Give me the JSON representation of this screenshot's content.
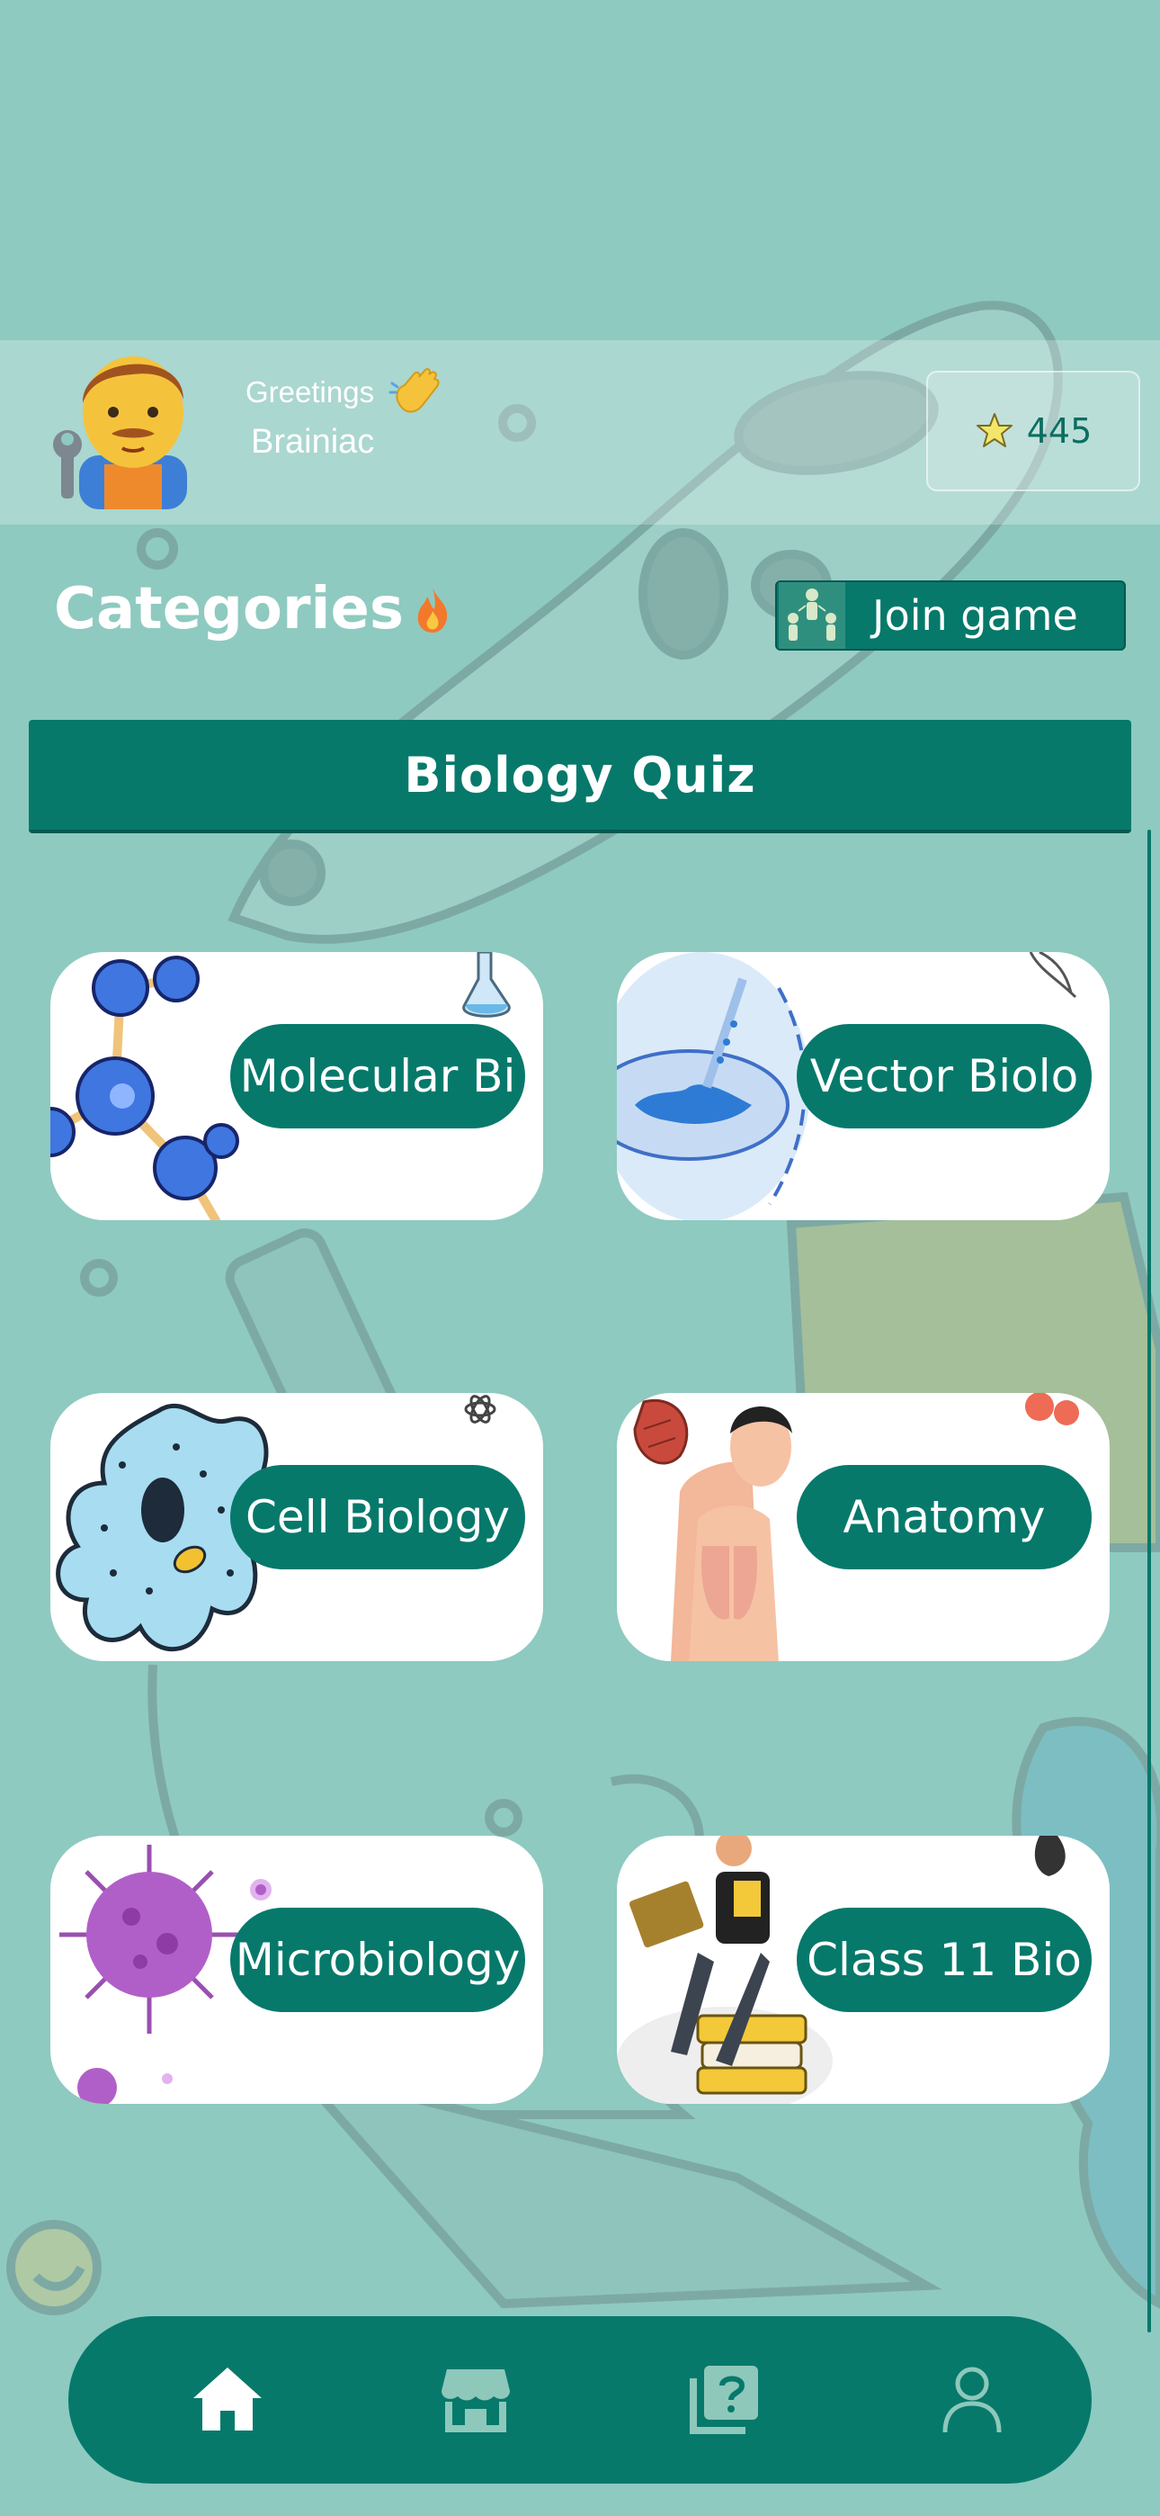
{
  "header": {
    "greeting": "Greetings",
    "username": "Brainiac",
    "score": "445"
  },
  "categories": {
    "title": "Categories",
    "join_button": "Join game"
  },
  "quiz": {
    "title": "Biology Quiz"
  },
  "cards": [
    {
      "label": "Molecular Bi"
    },
    {
      "label": "Vector Biolo"
    },
    {
      "label": "Cell Biology"
    },
    {
      "label": "Anatomy"
    },
    {
      "label": "Microbiology"
    },
    {
      "label": "Class 11 Bio"
    }
  ],
  "nav": {
    "items": [
      "home-icon",
      "store-icon",
      "quiz-icon",
      "profile-icon"
    ],
    "active": "home-icon"
  },
  "colors": {
    "background": "#8ecac0",
    "accent": "#06796b",
    "card": "#ffffff"
  }
}
